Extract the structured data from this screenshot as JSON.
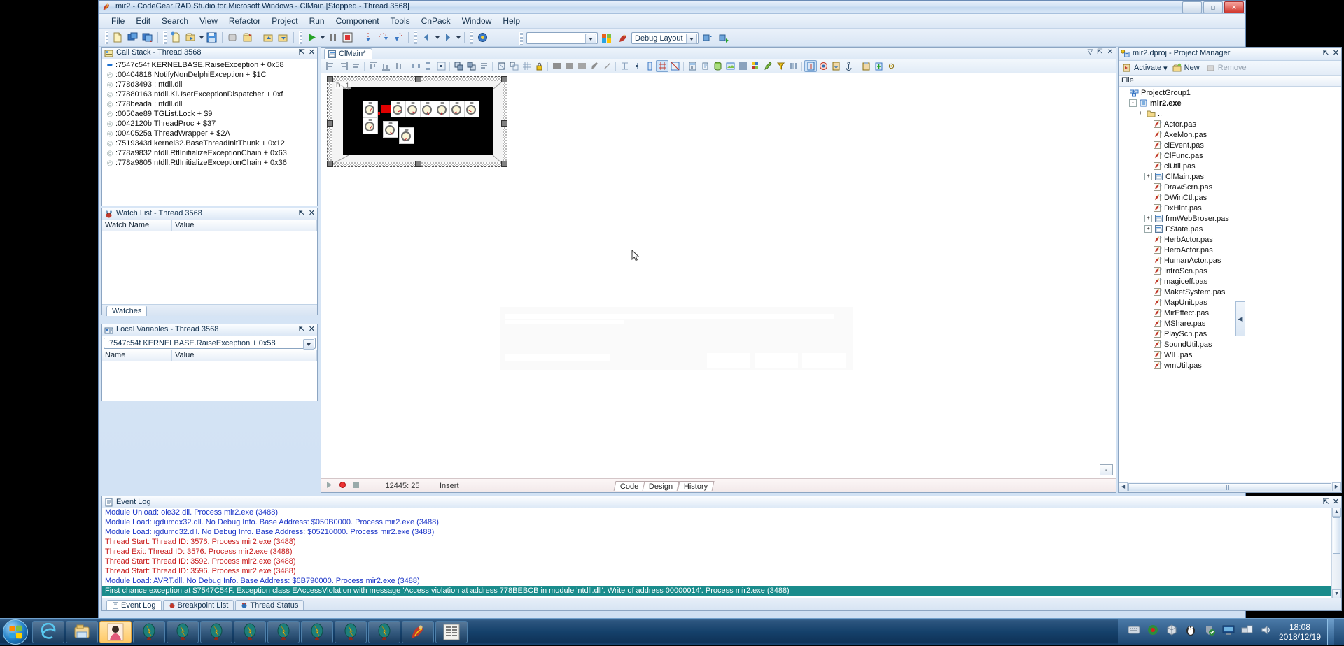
{
  "window": {
    "title": "mir2 - CodeGear RAD Studio for Microsoft Windows - ClMain [Stopped - Thread 3568]",
    "icon": "rad-studio-icon",
    "minimize": "–",
    "maximize": "□",
    "close": "✕"
  },
  "menu": {
    "items": [
      "File",
      "Edit",
      "Search",
      "View",
      "Refactor",
      "Project",
      "Run",
      "Component",
      "Tools",
      "CnPack",
      "Window",
      "Help"
    ]
  },
  "toolbar": {
    "desktop_combo_value": "",
    "layout_combo_value": "Debug Layout"
  },
  "call_stack": {
    "title": "Call Stack - Thread 3568",
    "icon": "call-stack-icon",
    "pin": "⇱",
    "close": "✕",
    "rows": [
      ":7547c54f KERNELBASE.RaiseException + 0x58",
      ":00404818 NotifyNonDelphiException + $1C",
      ":778d3493 ; ntdll.dll",
      ":77880163 ntdll.KiUserExceptionDispatcher + 0xf",
      ":778beada ; ntdll.dll",
      ":0050ae89 TGList.Lock + $9",
      ":0042120b ThreadProc + $37",
      ":0040525a ThreadWrapper + $2A",
      ":7519343d kernel32.BaseThreadInitThunk + 0x12",
      ":778a9832 ntdll.RtlInitializeExceptionChain + 0x63",
      ":778a9805 ntdll.RtlInitializeExceptionChain + 0x36"
    ]
  },
  "watch_list": {
    "title": "Watch List - Thread 3568",
    "icon": "watch-list-icon",
    "pin": "⇱",
    "close": "✕",
    "columns": [
      "Watch Name",
      "Value"
    ],
    "rows": [],
    "tabs": [
      "Watches"
    ]
  },
  "local_variables": {
    "title": "Local Variables - Thread 3568",
    "icon": "local-variables-icon",
    "pin": "⇱",
    "close": "✕",
    "frame_combo_value": ":7547c54f KERNELBASE.RaiseException + 0x58",
    "columns": [
      "Name",
      "Value"
    ],
    "rows": []
  },
  "editor": {
    "tab_label": "ClMain*",
    "tab_icon": "form-file-icon",
    "status": {
      "cursor_position": "12445: 25",
      "insert_mode": "Insert",
      "modified": ""
    },
    "view_tabs": [
      "Code",
      "Design",
      "History"
    ],
    "form_caption": "D...1",
    "zoom_button": "-"
  },
  "project_manager": {
    "title": "mir2.dproj - Project Manager",
    "icon": "project-manager-icon",
    "pin": "⇱",
    "close": "✕",
    "toolbar": {
      "activate": "Activate",
      "new": "New",
      "remove": "Remove"
    },
    "column_header": "File",
    "tree": [
      {
        "label": "ProjectGroup1",
        "indent": 0,
        "icon": "project-group-icon",
        "expander": "",
        "bold": false
      },
      {
        "label": "mir2.exe",
        "indent": 1,
        "icon": "exe-icon",
        "expander": "-",
        "bold": true
      },
      {
        "label": "..",
        "indent": 2,
        "icon": "folder-icon",
        "expander": "+",
        "bold": false
      },
      {
        "label": "Actor.pas",
        "indent": 3,
        "icon": "pas-icon",
        "expander": "",
        "bold": false
      },
      {
        "label": "AxeMon.pas",
        "indent": 3,
        "icon": "pas-icon",
        "expander": "",
        "bold": false
      },
      {
        "label": "clEvent.pas",
        "indent": 3,
        "icon": "pas-icon",
        "expander": "",
        "bold": false
      },
      {
        "label": "ClFunc.pas",
        "indent": 3,
        "icon": "pas-icon",
        "expander": "",
        "bold": false
      },
      {
        "label": "clUtil.pas",
        "indent": 3,
        "icon": "pas-icon",
        "expander": "",
        "bold": false
      },
      {
        "label": "ClMain.pas",
        "indent": 3,
        "icon": "unit-form-icon",
        "expander": "+",
        "bold": false
      },
      {
        "label": "DrawScrn.pas",
        "indent": 3,
        "icon": "pas-icon",
        "expander": "",
        "bold": false
      },
      {
        "label": "DWinCtl.pas",
        "indent": 3,
        "icon": "pas-icon",
        "expander": "",
        "bold": false
      },
      {
        "label": "DxHint.pas",
        "indent": 3,
        "icon": "pas-icon",
        "expander": "",
        "bold": false
      },
      {
        "label": "frmWebBroser.pas",
        "indent": 3,
        "icon": "unit-form-icon",
        "expander": "+",
        "bold": false
      },
      {
        "label": "FState.pas",
        "indent": 3,
        "icon": "unit-form-icon",
        "expander": "+",
        "bold": false
      },
      {
        "label": "HerbActor.pas",
        "indent": 3,
        "icon": "pas-icon",
        "expander": "",
        "bold": false
      },
      {
        "label": "HeroActor.pas",
        "indent": 3,
        "icon": "pas-icon",
        "expander": "",
        "bold": false
      },
      {
        "label": "HumanActor.pas",
        "indent": 3,
        "icon": "pas-icon",
        "expander": "",
        "bold": false
      },
      {
        "label": "IntroScn.pas",
        "indent": 3,
        "icon": "pas-icon",
        "expander": "",
        "bold": false
      },
      {
        "label": "magiceff.pas",
        "indent": 3,
        "icon": "pas-icon",
        "expander": "",
        "bold": false
      },
      {
        "label": "MaketSystem.pas",
        "indent": 3,
        "icon": "pas-icon",
        "expander": "",
        "bold": false
      },
      {
        "label": "MapUnit.pas",
        "indent": 3,
        "icon": "pas-icon",
        "expander": "",
        "bold": false
      },
      {
        "label": "MirEffect.pas",
        "indent": 3,
        "icon": "pas-icon",
        "expander": "",
        "bold": false
      },
      {
        "label": "MShare.pas",
        "indent": 3,
        "icon": "pas-icon",
        "expander": "",
        "bold": false
      },
      {
        "label": "PlayScn.pas",
        "indent": 3,
        "icon": "pas-icon",
        "expander": "",
        "bold": false
      },
      {
        "label": "SoundUtil.pas",
        "indent": 3,
        "icon": "pas-icon",
        "expander": "",
        "bold": false
      },
      {
        "label": "WIL.pas",
        "indent": 3,
        "icon": "pas-icon",
        "expander": "",
        "bold": false
      },
      {
        "label": "wmUtil.pas",
        "indent": 3,
        "icon": "pas-icon",
        "expander": "",
        "bold": false
      }
    ]
  },
  "event_log": {
    "title": "Event Log",
    "icon": "event-log-icon",
    "pin": "⇱",
    "close": "✕",
    "rows": [
      {
        "text": "Module Unload: ole32.dll. Process mir2.exe (3488)",
        "kind": "blue"
      },
      {
        "text": "Module Load: igdumdx32.dll. No Debug Info. Base Address: $050B0000. Process mir2.exe (3488)",
        "kind": "blue"
      },
      {
        "text": "Module Load: igdumd32.dll. No Debug Info. Base Address: $05210000. Process mir2.exe (3488)",
        "kind": "blue"
      },
      {
        "text": "Thread Start: Thread ID: 3576. Process mir2.exe (3488)",
        "kind": "red"
      },
      {
        "text": "Thread Exit: Thread ID: 3576. Process mir2.exe (3488)",
        "kind": "red"
      },
      {
        "text": "Thread Start: Thread ID: 3592. Process mir2.exe (3488)",
        "kind": "red"
      },
      {
        "text": "Thread Start: Thread ID: 3596. Process mir2.exe (3488)",
        "kind": "red"
      },
      {
        "text": "Module Load: AVRT.dll. No Debug Info. Base Address: $6B790000. Process mir2.exe (3488)",
        "kind": "blue"
      },
      {
        "text": "First chance exception at $7547C54F. Exception class EAccessViolation with message 'Access violation at address 778BEBCB in module 'ntdll.dll'. Write of address 00000014'. Process mir2.exe (3488)",
        "kind": "sel"
      }
    ],
    "tabs": [
      "Event Log",
      "Breakpoint List",
      "Thread Status"
    ],
    "tab_icons": [
      "event-log-icon",
      "breakpoint-icon",
      "thread-status-icon"
    ]
  },
  "taskbar": {
    "start": "start-orb",
    "items": [
      {
        "icon": "internet-explorer-icon",
        "active": false
      },
      {
        "icon": "folder-explorer-icon",
        "active": false
      },
      {
        "icon": "photo-viewer-icon",
        "active": true
      },
      {
        "icon": "mir2-client-icon",
        "active": false
      },
      {
        "icon": "mir2-client-icon",
        "active": false
      },
      {
        "icon": "mir2-client-icon",
        "active": false
      },
      {
        "icon": "mir2-client-icon",
        "active": false
      },
      {
        "icon": "mir2-client-icon",
        "active": false
      },
      {
        "icon": "mir2-client-icon",
        "active": false
      },
      {
        "icon": "mir2-client-icon",
        "active": false
      },
      {
        "icon": "mir2-client-icon",
        "active": false
      },
      {
        "icon": "rad-studio-icon",
        "active": false
      },
      {
        "icon": "chinese-app-icon",
        "active": false
      }
    ],
    "tray_icons": [
      "show-desktop-icon",
      "ime-icon",
      "media-icon",
      "cube-icon",
      "qq-penguin-icon",
      "antivirus-icon",
      "display-icon",
      "network-icon",
      "volume-icon"
    ],
    "clock_time": "18:08",
    "clock_date": "2018/12/19"
  },
  "colors": {
    "accent": "#1a8c8c",
    "log_blue": "#1b35c8",
    "log_red": "#c81b1b",
    "chrome": "#d2e2f4",
    "taskbar": "#15416b"
  }
}
